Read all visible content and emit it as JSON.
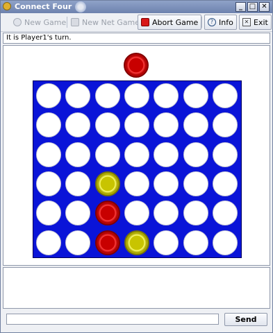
{
  "window": {
    "title": "Connect Four"
  },
  "toolbar": {
    "new_game": "New Game",
    "new_net_game": "New Net Game",
    "abort_game": "Abort Game",
    "info": "Info",
    "exit": "Exit"
  },
  "status": {
    "text": "It is Player1's turn."
  },
  "game": {
    "rows": 6,
    "cols": 7,
    "current_player_color": "red",
    "hover_column": 3,
    "pieces": [
      {
        "row": 4,
        "col": 3,
        "color": "yellow"
      },
      {
        "row": 5,
        "col": 3,
        "color": "red"
      },
      {
        "row": 6,
        "col": 3,
        "color": "red"
      },
      {
        "row": 6,
        "col": 4,
        "color": "yellow"
      }
    ],
    "colors": {
      "board": "#0a14d8",
      "red": "#d00000",
      "yellow": "#e0dc00"
    }
  },
  "chat": {
    "messages": "",
    "input_value": "",
    "send_label": "Send"
  }
}
